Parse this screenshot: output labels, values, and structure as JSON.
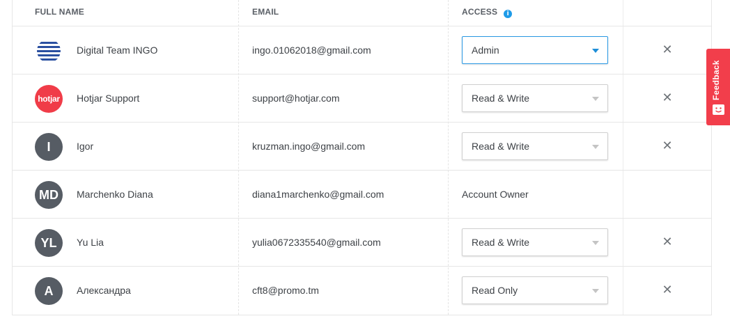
{
  "table": {
    "headers": {
      "full_name": "FULL NAME",
      "email": "EMAIL",
      "access": "ACCESS",
      "access_info_icon": "i"
    },
    "rows": [
      {
        "avatar_type": "logo",
        "avatar_text": "",
        "name": "Digital Team INGO",
        "email": "ingo.01062018@gmail.com",
        "access": "Admin",
        "access_editable": true,
        "removable": true
      },
      {
        "avatar_type": "hotjar",
        "avatar_text": "hotjar",
        "name": "Hotjar Support",
        "email": "support@hotjar.com",
        "access": "Read & Write",
        "access_editable": true,
        "removable": true
      },
      {
        "avatar_type": "initials",
        "avatar_text": "I",
        "name": "Igor",
        "email": "kruzman.ingo@gmail.com",
        "access": "Read & Write",
        "access_editable": true,
        "removable": true
      },
      {
        "avatar_type": "initials",
        "avatar_text": "MD",
        "name": "Marchenko Diana",
        "email": "diana1marchenko@gmail.com",
        "access": "Account Owner",
        "access_editable": false,
        "removable": false
      },
      {
        "avatar_type": "initials",
        "avatar_text": "YL",
        "name": "Yu Lia",
        "email": "yulia0672335540@gmail.com",
        "access": "Read & Write",
        "access_editable": true,
        "removable": true
      },
      {
        "avatar_type": "initials",
        "avatar_text": "A",
        "name": "Александра",
        "email": "cft8@promo.tm",
        "access": "Read Only",
        "access_editable": true,
        "removable": true
      }
    ],
    "remove_icon": "✕"
  },
  "feedback": {
    "label": "Feedback",
    "icon": "smiley-icon"
  },
  "colors": {
    "accent_blue": "#1e9be8",
    "avatar_gray": "#565c64",
    "hotjar_red": "#f03c48",
    "feedback_red": "#f23e4b"
  }
}
